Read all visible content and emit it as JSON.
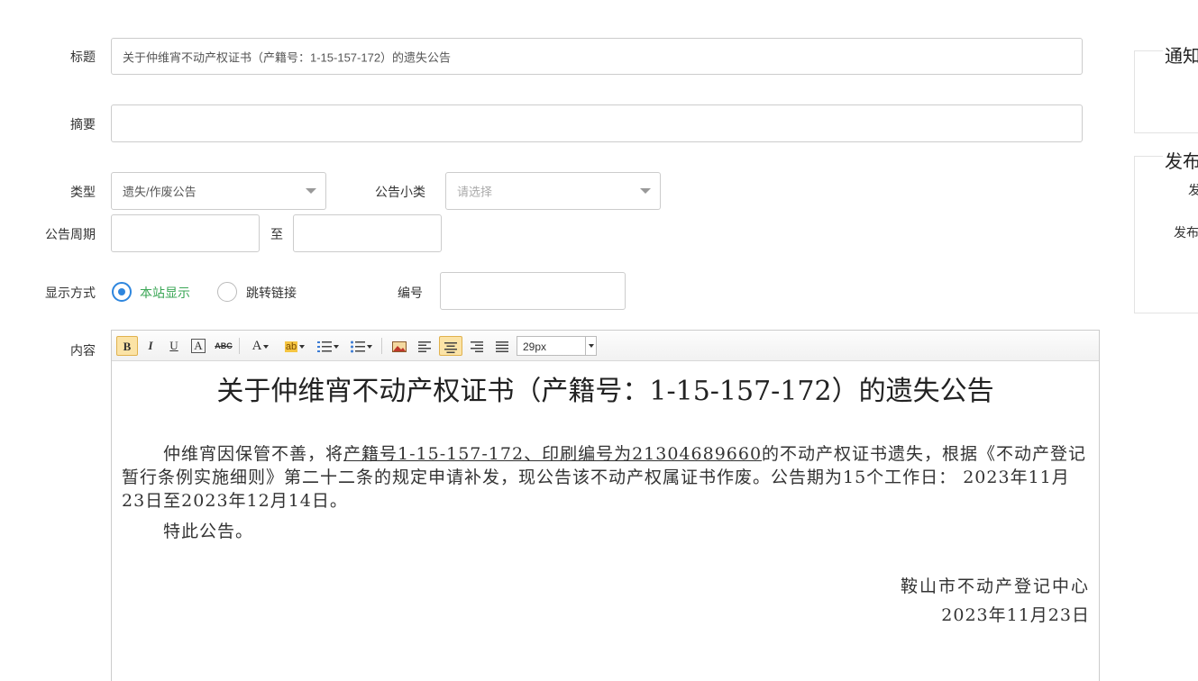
{
  "form": {
    "title_label": "标题",
    "title_value": "关于仲维宵不动产权证书（产籍号：1-15-157-172）的遗失公告",
    "summary_label": "摘要",
    "summary_value": "",
    "type_label": "类型",
    "type_value": "遗失/作废公告",
    "subtype_label": "公告小类",
    "subtype_placeholder": "请选择",
    "period_label": "公告周期",
    "period_start": "",
    "period_to": "至",
    "period_end": "",
    "display_label": "显示方式",
    "display_options": [
      "本站显示",
      "跳转链接"
    ],
    "display_selected": "本站显示",
    "number_label": "编号",
    "number_value": "",
    "content_label": "内容"
  },
  "toolbar": {
    "bold": "B",
    "italic": "I",
    "underline": "U",
    "font_border": "A",
    "strike": "ABC",
    "font_color": "A",
    "highlight": "ab",
    "font_size": "29px"
  },
  "content": {
    "title": "关于仲维宵不动产权证书（产籍号：1-15-157-172）的遗失公告",
    "para1_prefix": "仲维宵因保管不善，将",
    "para1_underlined": "产籍号1-15-157-172、印刷编号为21304689660",
    "para1_suffix": "的不动产权证书遗失，根据《不动产登记暂行条例实施细则》第二十二条的规定申请补发，现公告该不动产权属证书作废。公告期为15个工作日： 2023年11月23日至2023年12月14日。",
    "closing": "特此公告。",
    "org": "鞍山市不动产登记中心",
    "date": "2023年11月23日"
  },
  "side_panel": {
    "notice_title": "通知",
    "publish_title": "发布",
    "label_1": "发",
    "label_2": "发布"
  },
  "colors": {
    "accent": "#2e86de",
    "selected_text": "#3aa655",
    "active_button": "#fbe3a6"
  }
}
